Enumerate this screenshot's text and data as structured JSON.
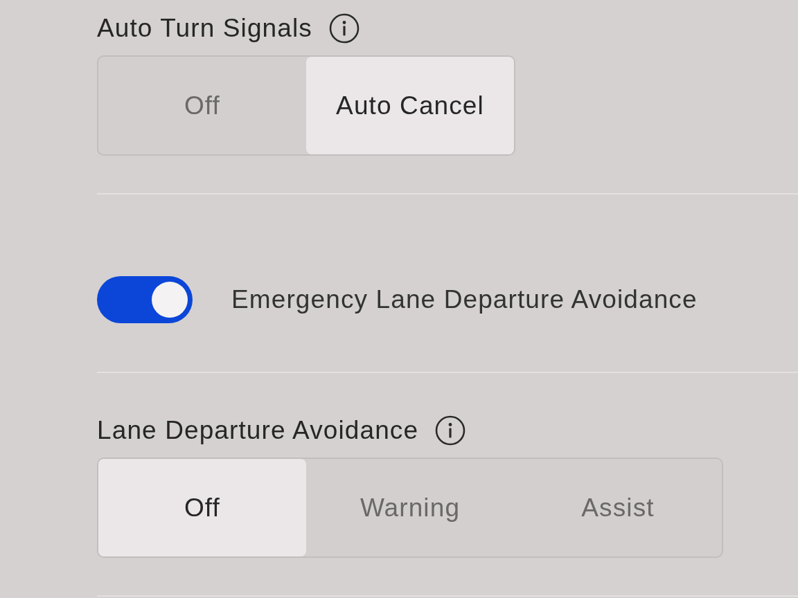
{
  "sections": [
    {
      "kind": "segmented",
      "title": "Auto Turn Signals",
      "info": true,
      "options": [
        {
          "label": "Off",
          "selected": false
        },
        {
          "label": "Auto Cancel",
          "selected": true
        }
      ]
    },
    {
      "kind": "toggle",
      "label": "Emergency Lane Departure Avoidance",
      "on": true
    },
    {
      "kind": "segmented",
      "title": "Lane Departure Avoidance",
      "info": true,
      "options": [
        {
          "label": "Off",
          "selected": true
        },
        {
          "label": "Warning",
          "selected": false
        },
        {
          "label": "Assist",
          "selected": false
        }
      ]
    }
  ]
}
